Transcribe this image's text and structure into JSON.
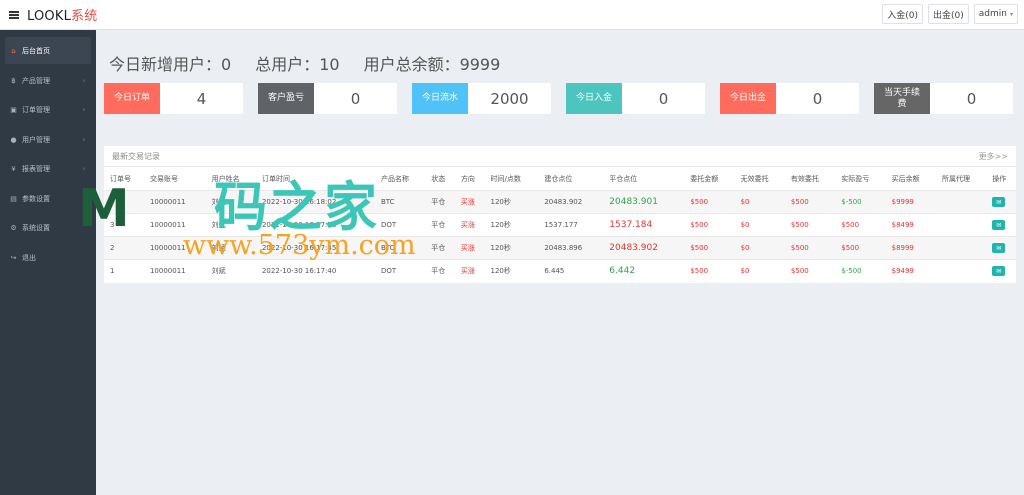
{
  "brand": {
    "name": "LOOKL",
    "suffix": "系统"
  },
  "topbar": {
    "deposit": "入金(0)",
    "withdraw": "出金(0)",
    "user": "admin"
  },
  "sidebar": {
    "items": [
      {
        "label": "后台首页",
        "icon": "⌂",
        "arrow": ""
      },
      {
        "label": "产品管理",
        "icon": "฿",
        "arrow": "›"
      },
      {
        "label": "订单管理",
        "icon": "▣",
        "arrow": "›"
      },
      {
        "label": "用户管理",
        "icon": "●",
        "arrow": "›"
      },
      {
        "label": "报表管理",
        "icon": "¥",
        "arrow": "›"
      },
      {
        "label": "参数设置",
        "icon": "▤",
        "arrow": ""
      },
      {
        "label": "系统设置",
        "icon": "⚙",
        "arrow": ""
      },
      {
        "label": "退出",
        "icon": "↪",
        "arrow": ""
      }
    ]
  },
  "summary": {
    "today_new_users": "今日新增用户：0",
    "total_users": "总用户：10",
    "total_balance": "用户总余额：9999"
  },
  "stats": [
    {
      "label": "今日订单",
      "value": "4",
      "color": "#ff6b5d"
    },
    {
      "label": "客户盈亏",
      "value": "0",
      "color": "#5f6368"
    },
    {
      "label": "今日流水",
      "value": "2000",
      "color": "#4fc3f7"
    },
    {
      "label": "今日入金",
      "value": "0",
      "color": "#4cc5bf"
    },
    {
      "label": "今日出金",
      "value": "0",
      "color": "#ff6b5d"
    },
    {
      "label": "当天手续费",
      "value": "0",
      "color": "#666"
    }
  ],
  "panel": {
    "title": "最新交易记录",
    "more": "更多>>"
  },
  "table": {
    "headers": [
      "订单号",
      "交易账号",
      "用户姓名",
      "订单时间",
      "产品名称",
      "状态",
      "方向",
      "时间/点数",
      "建仓点位",
      "平仓点位",
      "委托金额",
      "无效委托",
      "有效委托",
      "实际盈亏",
      "买后余额",
      "所属代理",
      "操作"
    ],
    "rows": [
      [
        "4",
        "10000011",
        "刘斌",
        "2022-10-30 16:18:02",
        "BTC",
        "平仓",
        "买涨",
        "120秒",
        "20483.902",
        "20483.901",
        "$500",
        "$0",
        "$500",
        "$-500",
        "$9999",
        "",
        "✉"
      ],
      [
        "3",
        "10000011",
        "刘斌",
        "2022-10-30 16:17:58",
        "DOT",
        "平仓",
        "买涨",
        "120秒",
        "1537.177",
        "1537.184",
        "$500",
        "$0",
        "$500",
        "$500",
        "$8499",
        "",
        "✉"
      ],
      [
        "2",
        "10000011",
        "刘斌",
        "2022-10-30 16:17:45",
        "BTC",
        "平仓",
        "买涨",
        "120秒",
        "20483.896",
        "20483.902",
        "$500",
        "$0",
        "$500",
        "$500",
        "$8999",
        "",
        "✉"
      ],
      [
        "1",
        "10000011",
        "刘斌",
        "2022-10-30 16:17:40",
        "DOT",
        "平仓",
        "买涨",
        "120秒",
        "6.445",
        "6.442",
        "$500",
        "$0",
        "$500",
        "$-500",
        "$9499",
        "",
        "✉"
      ]
    ]
  },
  "watermark": {
    "logo": "M",
    "title": "码之家",
    "url": "www.573ym.com"
  }
}
